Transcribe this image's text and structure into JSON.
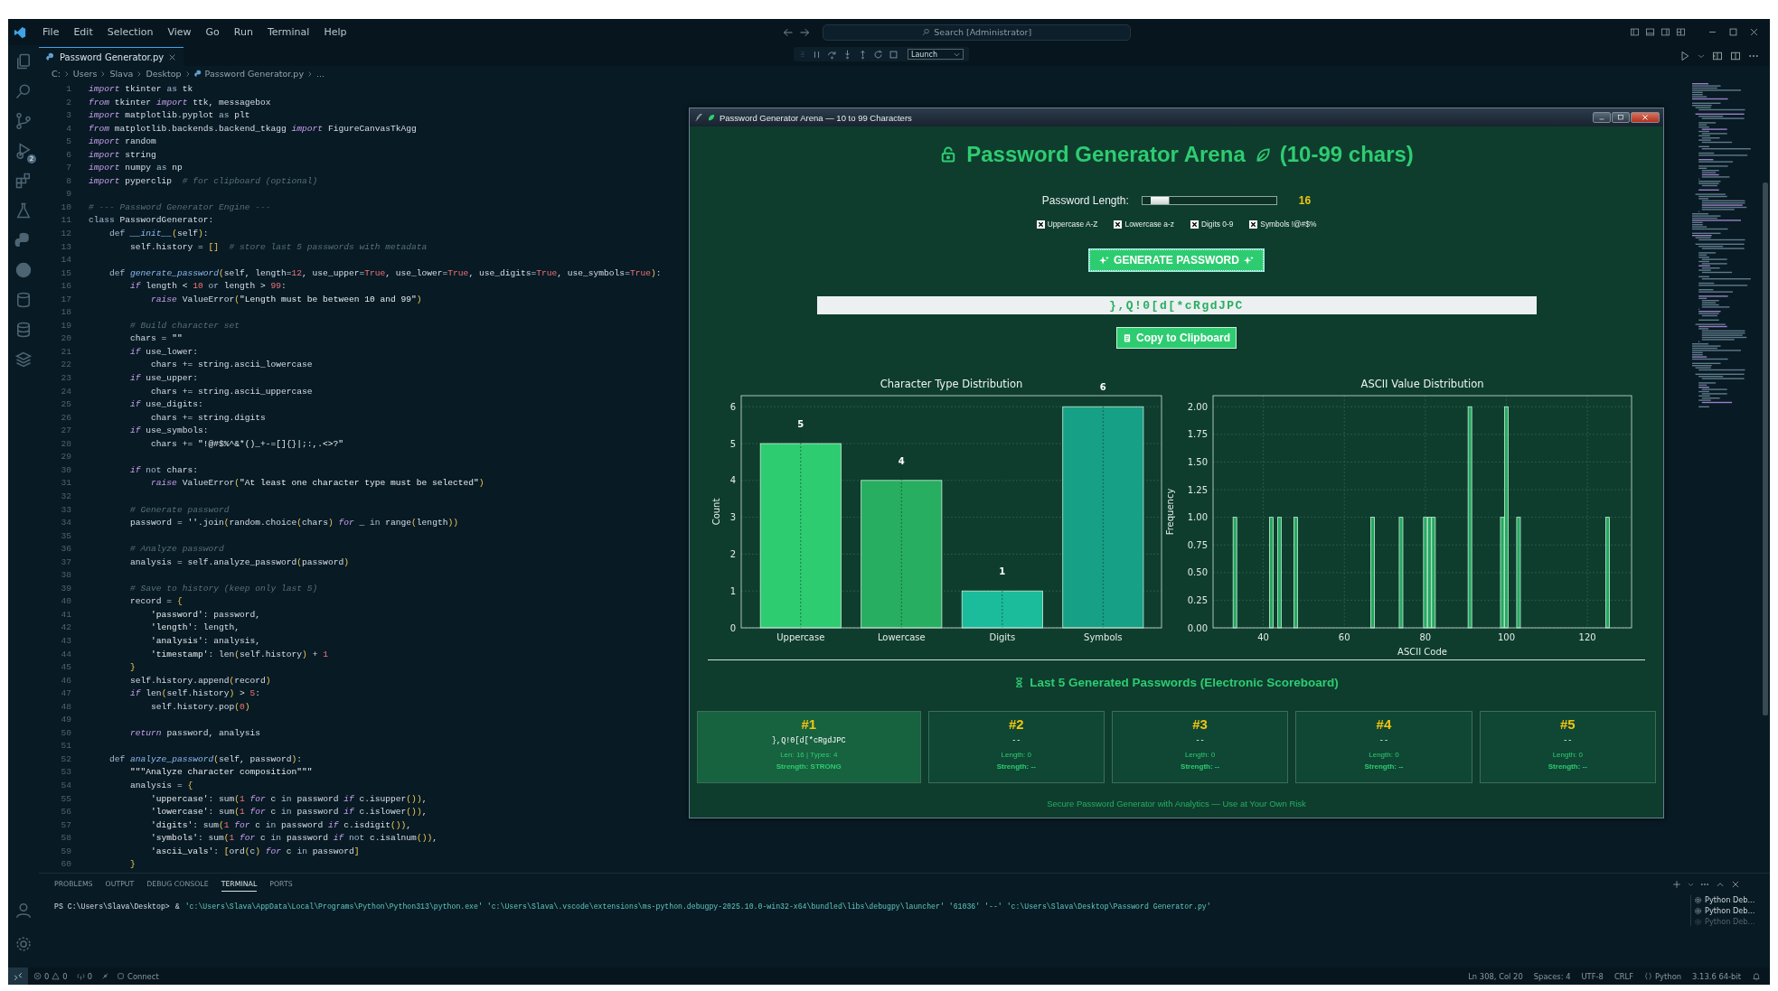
{
  "titlebar": {
    "menu": [
      "File",
      "Edit",
      "Selection",
      "View",
      "Go",
      "Run",
      "Terminal",
      "Help"
    ],
    "search": {
      "placeholder": "Search [Administrator]"
    }
  },
  "debug_toolbar": {
    "configuration": "Launch"
  },
  "activity_bar": {
    "badge": "2"
  },
  "tabs": [
    {
      "label": "Password Generator.py",
      "selected": true
    }
  ],
  "breadcrumb": [
    "C:",
    "Users",
    "Slava",
    "Desktop",
    "Password Generator.py",
    "..."
  ],
  "code": [
    {
      "n": "1",
      "text": "import tkinter as tk"
    },
    {
      "n": "2",
      "text": "from tkinter import ttk, messagebox"
    },
    {
      "n": "3",
      "text": "import matplotlib.pyplot as plt"
    },
    {
      "n": "4",
      "text": "from matplotlib.backends.backend_tkagg import FigureCanvasTkAgg"
    },
    {
      "n": "5",
      "text": "import random"
    },
    {
      "n": "6",
      "text": "import string"
    },
    {
      "n": "7",
      "text": "import numpy as np"
    },
    {
      "n": "8",
      "text": "import pyperclip  # for clipboard (optional)"
    },
    {
      "n": "9"
    },
    {
      "n": "10",
      "text": "# --- Password Generator Engine ---"
    },
    {
      "n": "11",
      "text": "class PasswordGenerator:"
    },
    {
      "n": "12",
      "text": "    def __init__(self):"
    },
    {
      "n": "13",
      "text": "        self.history = []  # store last 5 passwords with metadata"
    },
    {
      "n": "14"
    },
    {
      "n": "15",
      "text": "    def generate_password(self, length=12, use_upper=True, use_lower=True, use_digits=True, use_symbols=True):"
    },
    {
      "n": "16",
      "text": "        if length < 10 or length > 99:"
    },
    {
      "n": "17",
      "text": "            raise ValueError(\"Length must be between 10 and 99\")"
    },
    {
      "n": "18"
    },
    {
      "n": "19",
      "text": "        # Build character set"
    },
    {
      "n": "20",
      "text": "        chars = \"\""
    },
    {
      "n": "21",
      "text": "        if use_lower:"
    },
    {
      "n": "22",
      "text": "            chars += string.ascii_lowercase"
    },
    {
      "n": "23",
      "text": "        if use_upper:"
    },
    {
      "n": "24",
      "text": "            chars += string.ascii_uppercase"
    },
    {
      "n": "25",
      "text": "        if use_digits:"
    },
    {
      "n": "26",
      "text": "            chars += string.digits"
    },
    {
      "n": "27",
      "text": "        if use_symbols:"
    },
    {
      "n": "28",
      "text": "            chars += \"!@#$%^&*()_+-=[]{}|;:,.<>?\""
    },
    {
      "n": "29"
    },
    {
      "n": "30",
      "text": "        if not chars:"
    },
    {
      "n": "31",
      "text": "            raise ValueError(\"At least one character type must be selected\")"
    },
    {
      "n": "32"
    },
    {
      "n": "33",
      "text": "        # Generate password"
    },
    {
      "n": "34",
      "text": "        password = ''.join(random.choice(chars) for _ in range(length))"
    },
    {
      "n": "35"
    },
    {
      "n": "36",
      "text": "        # Analyze password"
    },
    {
      "n": "37",
      "text": "        analysis = self.analyze_password(password)"
    },
    {
      "n": "38"
    },
    {
      "n": "39",
      "text": "        # Save to history (keep only last 5)"
    },
    {
      "n": "40",
      "text": "        record = {"
    },
    {
      "n": "41",
      "text": "            'password': password,"
    },
    {
      "n": "42",
      "text": "            'length': length,"
    },
    {
      "n": "43",
      "text": "            'analysis': analysis,"
    },
    {
      "n": "44",
      "text": "            'timestamp': len(self.history) + 1"
    },
    {
      "n": "45",
      "text": "        }"
    },
    {
      "n": "46",
      "text": "        self.history.append(record)"
    },
    {
      "n": "47",
      "text": "        if len(self.history) > 5:"
    },
    {
      "n": "48",
      "text": "            self.history.pop(0)"
    },
    {
      "n": "49"
    },
    {
      "n": "50",
      "text": "        return password, analysis"
    },
    {
      "n": "51"
    },
    {
      "n": "52",
      "text": "    def analyze_password(self, password):"
    },
    {
      "n": "53",
      "text": "        \"\"\"Analyze character composition\"\"\""
    },
    {
      "n": "54",
      "text": "        analysis = {"
    },
    {
      "n": "55",
      "text": "            'uppercase': sum(1 for c in password if c.isupper()),"
    },
    {
      "n": "56",
      "text": "            'lowercase': sum(1 for c in password if c.islower()),"
    },
    {
      "n": "57",
      "text": "            'digits': sum(1 for c in password if c.isdigit()),"
    },
    {
      "n": "58",
      "text": "            'symbols': sum(1 for c in password if not c.isalnum()),"
    },
    {
      "n": "59",
      "text": "            'ascii_vals': [ord(c) for c in password]"
    },
    {
      "n": "60",
      "text": "        }"
    }
  ],
  "app_window": {
    "title": "Password Generator Arena — 10 to 99 Characters",
    "heading": "Password Generator Arena",
    "heading_suffix": "(10-99 chars)",
    "length_label": "Password Length:",
    "length_slider": {
      "level": 0.067
    },
    "length_value": "16",
    "options": [
      {
        "label": "Uppercase A-Z",
        "checked": true
      },
      {
        "label": "Lowercase a-z",
        "checked": true
      },
      {
        "label": "Digits 0-9",
        "checked": true
      },
      {
        "label": "Symbols !@#$%",
        "checked": true
      }
    ],
    "generate_button": "GENERATE PASSWORD",
    "password": "},Q!0[d[*cRgdJPC",
    "copy_button": "Copy to Clipboard",
    "charts": [
      {
        "chart_data": {
          "type": "bar",
          "title": "Character Type Distribution",
          "ylabel": "Count",
          "categories": [
            "Uppercase",
            "Lowercase",
            "Digits",
            "Symbols"
          ],
          "series": [
            {
              "colors": [
                "#2ecc71",
                "#27ae60",
                "#1abc9c",
                "#16a085"
              ],
              "values": [
                5,
                4,
                1,
                6
              ]
            }
          ],
          "ylim": [
            0,
            6.3
          ],
          "yticks": [
            0,
            1,
            2,
            3,
            4,
            5,
            6
          ],
          "data_labels": true,
          "grid": true
        }
      },
      {
        "chart_data": {
          "type": "bar",
          "title": "ASCII Value Distribution",
          "xlabel": "ASCII Code",
          "ylabel": "Frequency",
          "x": [
            33,
            42,
            44,
            48,
            67,
            74,
            80,
            81,
            82,
            91,
            99,
            100,
            103,
            125
          ],
          "series": [
            {
              "color": "#2ecc71",
              "values": [
                1,
                1,
                1,
                1,
                1,
                1,
                1,
                1,
                1,
                2,
                1,
                2,
                1,
                1
              ]
            }
          ],
          "xlim": [
            27.6,
            130.9
          ],
          "ylim": [
            0,
            2.1
          ],
          "xticks": [
            40,
            60,
            80,
            100,
            120
          ],
          "yticks": [
            {
              "value": 0,
              "label": "0.00"
            },
            {
              "value": 0.25,
              "label": "0.25"
            },
            {
              "value": 0.5,
              "label": "0.50"
            },
            {
              "value": 0.75,
              "label": "0.75"
            },
            {
              "value": 1,
              "label": "1.00"
            },
            {
              "value": 1.25,
              "label": "1.25"
            },
            {
              "value": 1.5,
              "label": "1.50"
            },
            {
              "value": 1.75,
              "label": "1.75"
            },
            {
              "value": 2,
              "label": "2.00"
            }
          ],
          "grid": true
        }
      }
    ],
    "scoreboard": {
      "title": "Last 5 Generated Passwords (Electronic Scoreboard)",
      "entries": [
        {
          "rank": "#1",
          "password": "},Q!0[d[*cRgdJPC",
          "stats": "Len: 16 | Types: 4",
          "strength": "Strength: STRONG",
          "highlighted": true
        },
        {
          "rank": "#2",
          "password": "--",
          "stats": "Length: 0",
          "strength": "Strength: --",
          "highlighted": false
        },
        {
          "rank": "#3",
          "password": "--",
          "stats": "Length: 0",
          "strength": "Strength: --",
          "highlighted": false
        },
        {
          "rank": "#4",
          "password": "--",
          "stats": "Length: 0",
          "strength": "Strength: --",
          "highlighted": false
        },
        {
          "rank": "#5",
          "password": "--",
          "stats": "Length: 0",
          "strength": "Strength: --",
          "highlighted": false
        }
      ]
    },
    "footer": "Secure Password Generator with Analytics — Use at Your Own Risk"
  },
  "panel": {
    "tabs": [
      {
        "label": "PROBLEMS",
        "selected": false
      },
      {
        "label": "OUTPUT",
        "selected": false
      },
      {
        "label": "DEBUG CONSOLE",
        "selected": false
      },
      {
        "label": "TERMINAL",
        "selected": true
      },
      {
        "label": "PORTS",
        "selected": false
      }
    ],
    "terminal": {
      "prompt": "PS C:\\Users\\Slava\\Desktop>",
      "operator": "&",
      "arguments": "'c:\\Users\\Slava\\AppData\\Local\\Programs\\Python\\Python313\\python.exe' 'c:\\Users\\Slava\\.vscode\\extensions\\ms-python.debugpy-2025.10.0-win32-x64\\bundled\\libs\\debugpy\\launcher' '61036' '--' 'c:\\Users\\Slava\\Desktop\\Password Generator.py'"
    },
    "sessions": [
      {
        "label": "Python Deb...",
        "dimmed": false
      },
      {
        "label": "Python Deb...",
        "dimmed": false
      },
      {
        "label": "Python Deb...",
        "dimmed": true
      }
    ]
  },
  "status_bar": {
    "errors": "0",
    "warnings": "0",
    "ports": "0",
    "connect": "Connect",
    "position": "Ln 308, Col 20",
    "indent": "Spaces: 4",
    "encoding": "UTF-8",
    "eol": "CRLF",
    "language": "Python",
    "interpreter": "3.13.6 64-bit"
  }
}
